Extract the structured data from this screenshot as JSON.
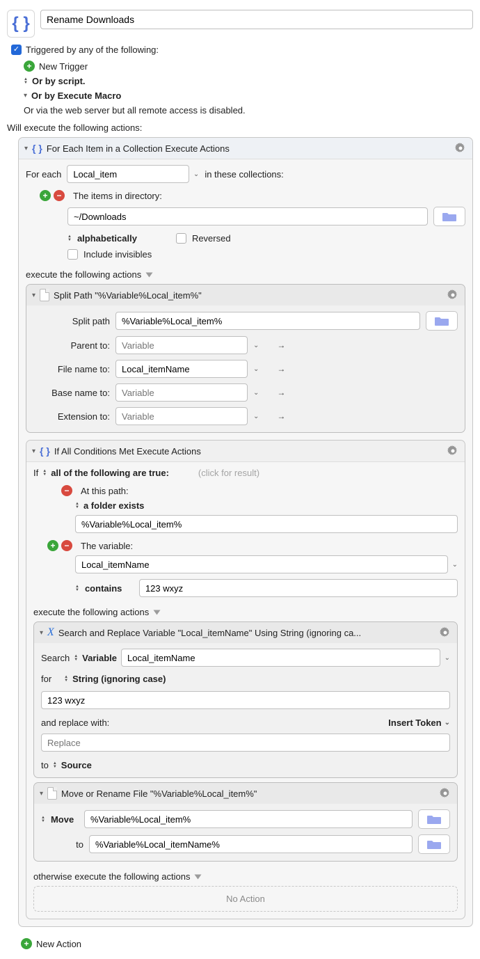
{
  "header": {
    "macro_name": "Rename Downloads",
    "triggered_label": "Triggered by any of the following:",
    "new_trigger": "New Trigger",
    "or_script": "Or by script.",
    "or_execute_macro": "Or by Execute Macro",
    "or_web": "Or via the web server but all remote access is disabled."
  },
  "exec_heading": "Will execute the following actions:",
  "foreach": {
    "title": "For Each Item in a Collection Execute Actions",
    "for_each_label": "For each",
    "var_name": "Local_item",
    "in_label": "in these collections:",
    "items_dir_label": "The items in directory:",
    "dir_value": "~/Downloads",
    "sort_label": "alphabetically",
    "reversed_label": "Reversed",
    "invisibles_label": "Include invisibles",
    "exec_label": "execute the following actions"
  },
  "split": {
    "title": "Split Path \"%Variable%Local_item%\"",
    "split_path_label": "Split path",
    "split_path_value": "%Variable%Local_item%",
    "rows": [
      {
        "label": "Parent to:",
        "value": "",
        "placeholder": "Variable"
      },
      {
        "label": "File name to:",
        "value": "Local_itemName",
        "placeholder": ""
      },
      {
        "label": "Base name to:",
        "value": "",
        "placeholder": "Variable"
      },
      {
        "label": "Extension to:",
        "value": "",
        "placeholder": "Variable"
      }
    ]
  },
  "ifcond": {
    "title": "If All Conditions Met Execute Actions",
    "if_label": "If",
    "all_label": "all of the following are true:",
    "click_hint": "(click for result)",
    "path_cond_label": "At this path:",
    "folder_exists": "a folder exists",
    "path_value": "%Variable%Local_item%",
    "var_cond_label": "The variable:",
    "var_name": "Local_itemName",
    "op": "contains",
    "op_value": "123 wxyz",
    "exec_label": "execute the following actions",
    "otherwise_label": "otherwise execute the following actions",
    "no_action": "No Action"
  },
  "search": {
    "title": "Search and Replace Variable \"Local_itemName\" Using String (ignoring ca...",
    "search_label": "Search",
    "variable_label": "Variable",
    "var_name": "Local_itemName",
    "for_label": "for",
    "for_type": "String (ignoring case)",
    "for_value": "123 wxyz",
    "replace_label": "and replace with:",
    "insert_token": "Insert Token",
    "replace_placeholder": "Replace",
    "to_label": "to",
    "to_target": "Source"
  },
  "move": {
    "title": "Move or Rename File \"%Variable%Local_item%\"",
    "move_label": "Move",
    "move_value": "%Variable%Local_item%",
    "to_label": "to",
    "to_value": "%Variable%Local_itemName%"
  },
  "footer": {
    "new_action": "New Action"
  }
}
